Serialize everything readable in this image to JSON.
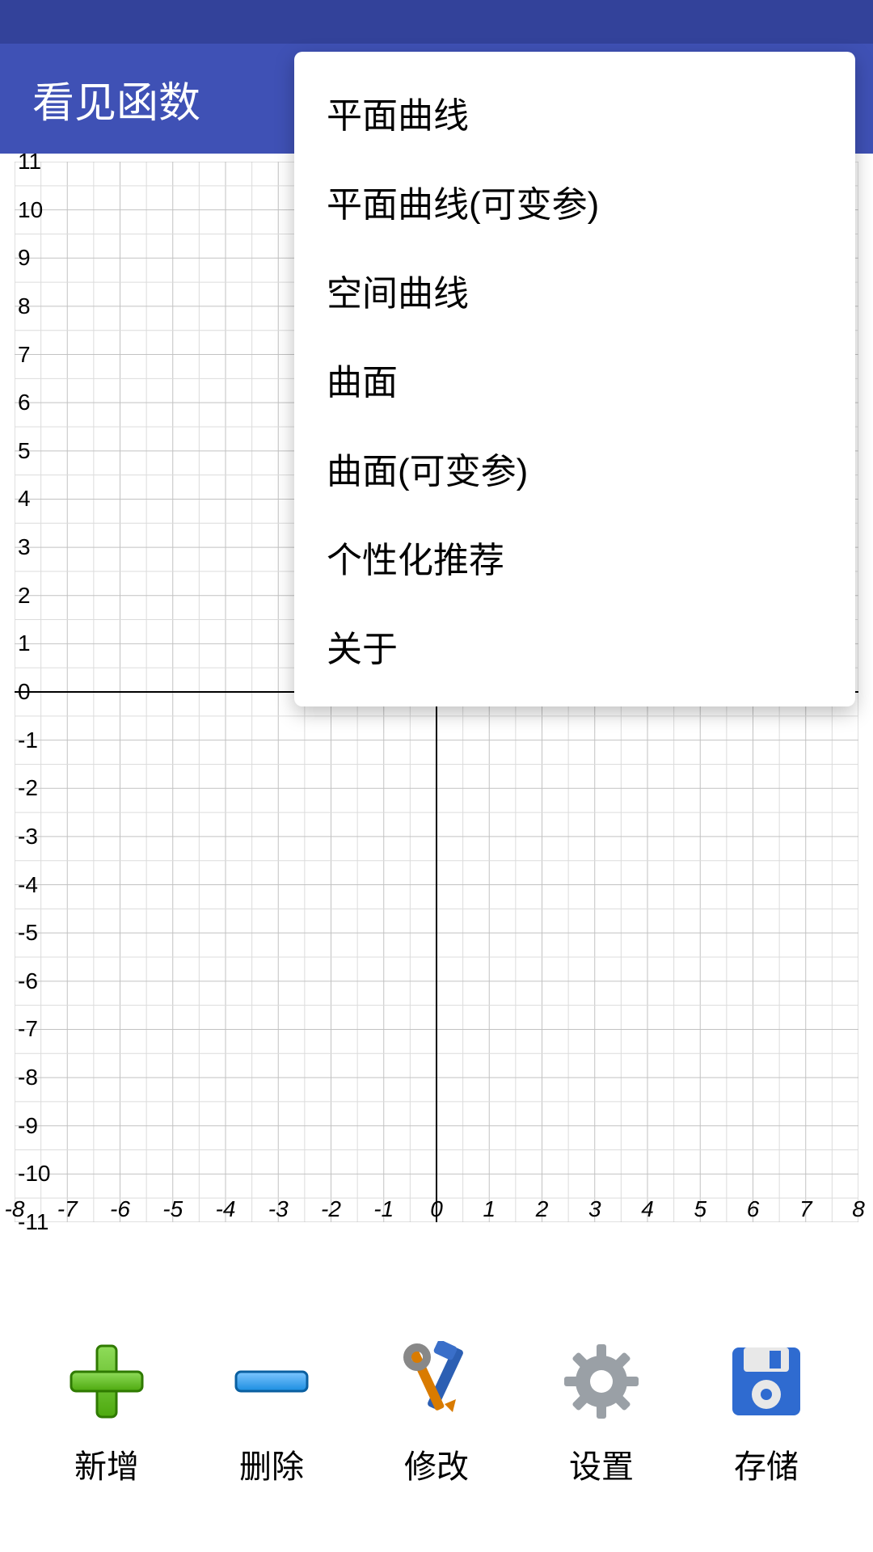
{
  "header": {
    "title": "看见函数"
  },
  "menu": {
    "items": [
      {
        "label": "平面曲线"
      },
      {
        "label": "平面曲线(可变参)"
      },
      {
        "label": "空间曲线"
      },
      {
        "label": "曲面"
      },
      {
        "label": "曲面(可变参)"
      },
      {
        "label": "个性化推荐"
      },
      {
        "label": "关于"
      }
    ]
  },
  "bottom": {
    "items": [
      {
        "label": "新增"
      },
      {
        "label": "删除"
      },
      {
        "label": "修改"
      },
      {
        "label": "设置"
      },
      {
        "label": "存储"
      }
    ]
  },
  "chart_data": {
    "type": "scatter",
    "series": [],
    "x_ticks": [
      -8,
      -7,
      -6,
      -5,
      -4,
      -3,
      -2,
      -1,
      0,
      1,
      2,
      3,
      4,
      5,
      6,
      7,
      8
    ],
    "x_tick_labels": [
      "-8",
      "-7",
      "-6",
      "-5",
      "-4",
      "-3",
      "-2",
      "-1",
      "0",
      "1",
      "2",
      "3",
      "4",
      "5",
      "6",
      "7",
      "8"
    ],
    "y_ticks": [
      -11,
      -10,
      -9,
      -8,
      -7,
      -6,
      -5,
      -4,
      -3,
      -2,
      -1,
      0,
      1,
      2,
      3,
      4,
      5,
      6,
      7,
      8,
      9,
      10,
      11
    ],
    "y_tick_labels": [
      "-11",
      "-10",
      "-9",
      "-8",
      "-7",
      "-6",
      "-5",
      "-4",
      "-3",
      "-2",
      "-1",
      "0",
      "1",
      "2",
      "3",
      "4",
      "5",
      "6",
      "7",
      "8",
      "9",
      "10",
      "11"
    ],
    "xlim": [
      -8,
      8
    ],
    "ylim": [
      -11,
      11
    ],
    "xlabel": "",
    "ylabel": "",
    "title": "",
    "grid": true
  }
}
